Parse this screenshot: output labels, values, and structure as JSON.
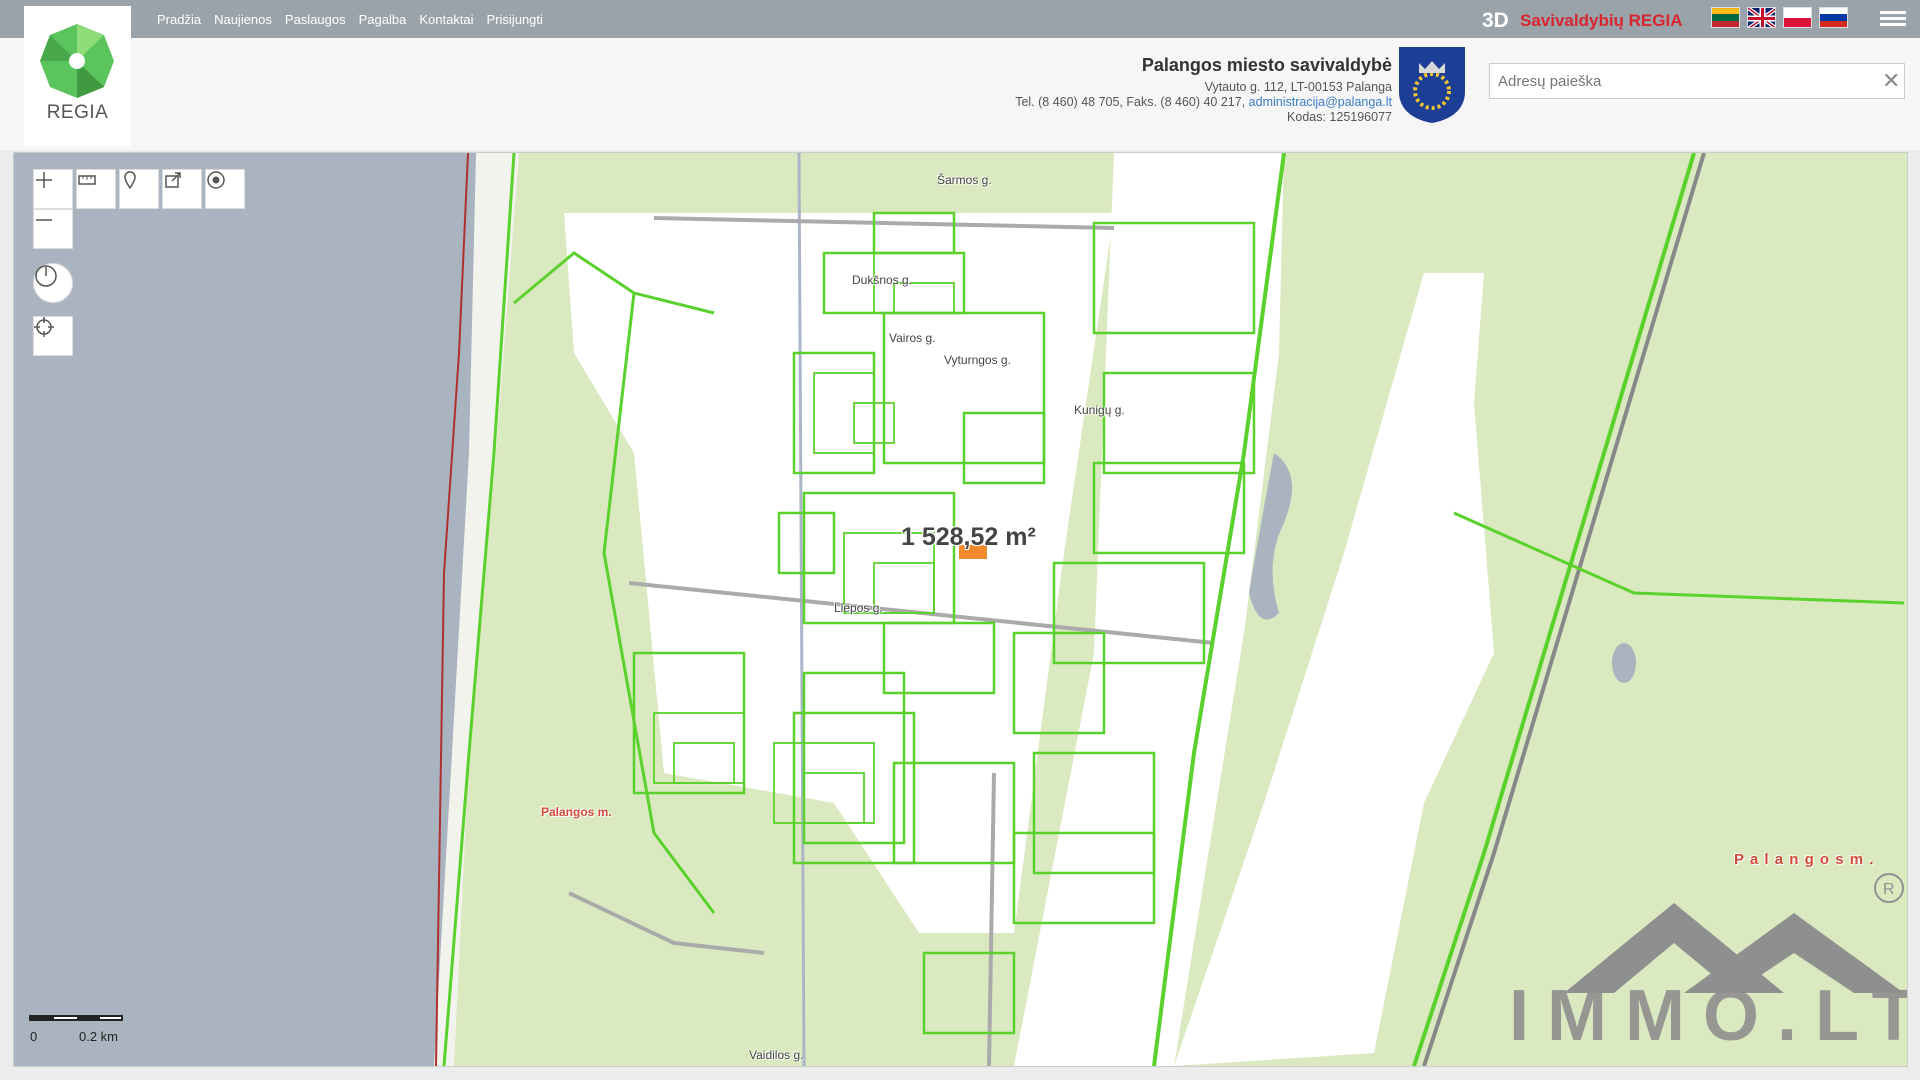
{
  "nav": {
    "items": [
      "Pradžia",
      "Naujienos",
      "Paslaugos",
      "Pagalba",
      "Kontaktai",
      "Prisijungti"
    ]
  },
  "brand": {
    "prefix": "3D",
    "name": "Savivaldybių REGIA"
  },
  "logo": {
    "text": "REGIA"
  },
  "municipality": {
    "title": "Palangos miesto savivaldybė",
    "address": "Vytauto g. 112, LT-00153 Palanga",
    "phone": "Tel. (8 460) 48 705, Faks. (8 460) 40 217,",
    "email": "administracija@palanga.lt",
    "code": "Kodas: 125196077"
  },
  "search": {
    "placeholder": "Adresų paieška"
  },
  "map": {
    "area_label": "1 528,52 m²",
    "place_label_1": "Palangos m.",
    "place_label_2": "P a l a n g o s   m .",
    "streets": {
      "s1": "Šarmos g.",
      "s2": "Dukšnos g.",
      "s3": "Vairos g.",
      "s4": "Vyturngos g.",
      "s5": "Kunigų g.",
      "s6": "Liepos g.",
      "s7": "Vaidilos g."
    },
    "scale": {
      "start": "0",
      "end": "0.2 km"
    }
  },
  "watermark": {
    "text": "IMMO.LT"
  },
  "colors": {
    "parcel": "#5ad12c",
    "land": "#d6e6b6",
    "water": "#a9b4c0",
    "road": "#8c8c8c",
    "accent": "#d8262e"
  }
}
